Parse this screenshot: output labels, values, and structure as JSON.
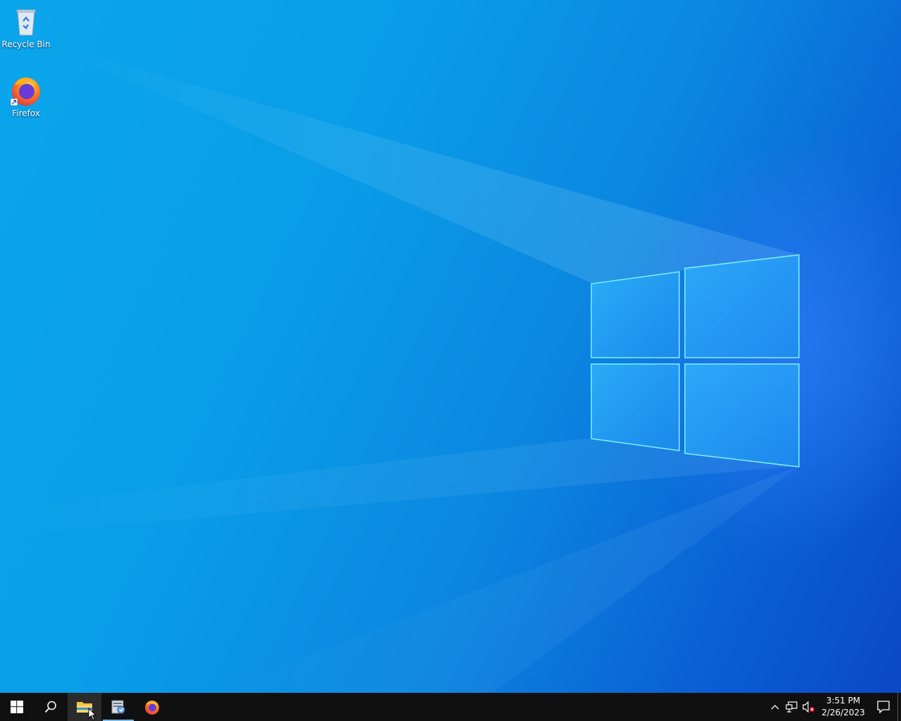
{
  "desktop": {
    "icons": [
      {
        "label": "Recycle Bin",
        "icon": "recycle-bin-icon"
      },
      {
        "label": "Firefox",
        "icon": "firefox-icon"
      }
    ],
    "wallpaper": "windows-10-hero-wallpaper"
  },
  "taskbar": {
    "start_icon": "windows-logo-icon",
    "search_icon": "search-icon",
    "pinned": [
      {
        "name": "File Explorer",
        "icon": "folder-icon",
        "state": "hover"
      },
      {
        "name": "Server Manager",
        "icon": "server-manager-icon",
        "state": "active"
      },
      {
        "name": "Firefox",
        "icon": "firefox-icon",
        "state": "normal"
      }
    ],
    "tray": {
      "chevron_icon": "chevron-up-icon",
      "network_icon": "network-icon",
      "volume_icon": "volume-muted-icon",
      "time": "3:51 PM",
      "date": "2/26/2023",
      "notification_icon": "action-center-icon"
    }
  },
  "colors": {
    "taskbar": "#101010",
    "accent": "#76b9ed",
    "wallpaper_light": "#0aa6ec",
    "wallpaper_dark": "#0a48c8"
  }
}
